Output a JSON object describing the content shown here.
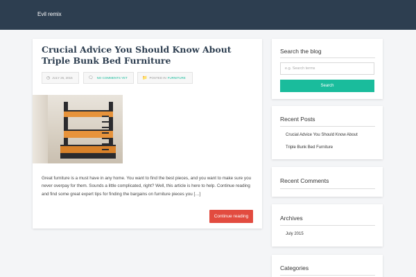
{
  "site": {
    "brand": "Evil remix"
  },
  "post": {
    "title": "Crucial Advice You Should Know About Triple Bunk Bed Furniture",
    "date": "JULY 25, 2015",
    "comments": "NO COMMENTS YET",
    "posted_in_label": "POSTED IN",
    "category": "FURNITURE",
    "image_alt": "triple bunk bed",
    "excerpt": "Great furniture is a must have in any home. You want to find the best pieces, and you want to make sure you never overpay for them. Sounds a little complicated, right? Well, this article is here to help. Continue reading and find some great expert tips for finding the bargains on furniture pieces you […]",
    "continue_label": "Continue reading"
  },
  "sidebar": {
    "search": {
      "title": "Search the blog",
      "placeholder": "e.g. Search terms",
      "button": "Search"
    },
    "recent_posts": {
      "title": "Recent Posts",
      "lines": [
        "Crucial Advice You Should Know About",
        "Triple Bunk Bed Furniture"
      ]
    },
    "recent_comments": {
      "title": "Recent Comments"
    },
    "archives": {
      "title": "Archives",
      "items": [
        "July 2015"
      ]
    },
    "categories": {
      "title": "Categories"
    }
  },
  "colors": {
    "header": "#2d3e50",
    "accent": "#1abc9c",
    "cta": "#e24b3f"
  },
  "icons": {
    "date": "clock-icon",
    "comments": "comment-icon",
    "category": "folder-icon"
  }
}
